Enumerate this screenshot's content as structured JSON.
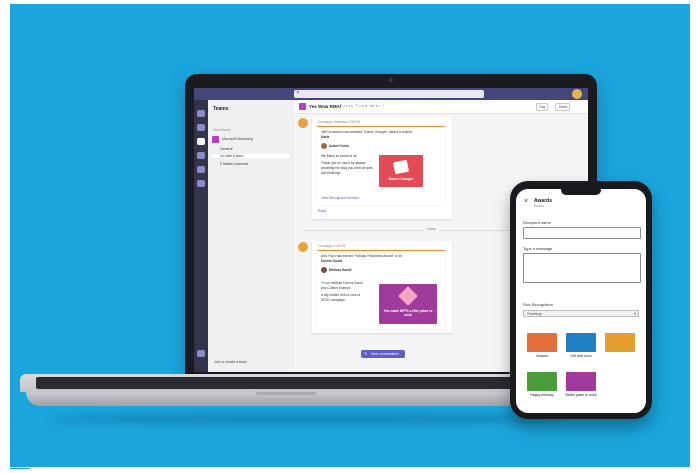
{
  "colors": {
    "background": "#1ba5dd",
    "teams_purple": "#5b5fc7",
    "team_tile": "#b83ac6"
  },
  "laptop": {
    "search_placeholder": "Search",
    "teams_title": "Teams",
    "teams_section_label": "Your teams",
    "team_name": "Microsoft Marketing",
    "channels": [
      "General",
      "Go with a team",
      "2 hidden channels"
    ],
    "join_label": "Join or create a team",
    "channel_title": "Yes Wow RMA!",
    "tabs": "Posts   Files   Wiki   +",
    "header_buttons": [
      "Org",
      "Team"
    ],
    "post1": {
      "meta": "Campaign  Yesterday 2:59 PM",
      "line1": "Jeff Kovanovic has awarded \"Game Changer\" Award to Aubert",
      "line2": "Karla",
      "person": "Aubert Kuhn",
      "note1": "We Many so proud of all",
      "note2": "Thank you so much for always",
      "note3": "providing the blog you work at work",
      "note4": "and finishing!",
      "badge_text": "Game Changer",
      "link": "View Recognition Moment",
      "reply": "Reply"
    },
    "date_divider": "Today",
    "post2": {
      "meta": "Campaign  2:18 PM",
      "line1": "Alex Fayo has earned \"Holiday Fellowship Award\" to be",
      "line2": "Dorma Gould",
      "person": "Melissa Gould",
      "note1": "To our Melissa Dorma Gould",
      "note2": "and Culture champs",
      "note3": "A big thanks from a cork of",
      "note4": "SSTE campaign",
      "badge_text": "You made BFFS a little place to work",
      "button": "New conversation"
    }
  },
  "phone": {
    "title": "Awards",
    "subtitle": "Kudos",
    "recipient_label": "Recipient name",
    "message_label": "Type a message",
    "pick_label": "Pick Recognition",
    "select_value": "Greetings",
    "tiles": [
      {
        "label": "Awards",
        "color": "#e36f3b"
      },
      {
        "label": "Get well soon",
        "color": "#1f7fc5"
      },
      {
        "label": "",
        "color": "#e59f2f"
      },
      {
        "label": "Happy birthday",
        "color": "#4a9c3c"
      },
      {
        "label": "Better place to work",
        "color": "#a03b9b"
      }
    ]
  }
}
